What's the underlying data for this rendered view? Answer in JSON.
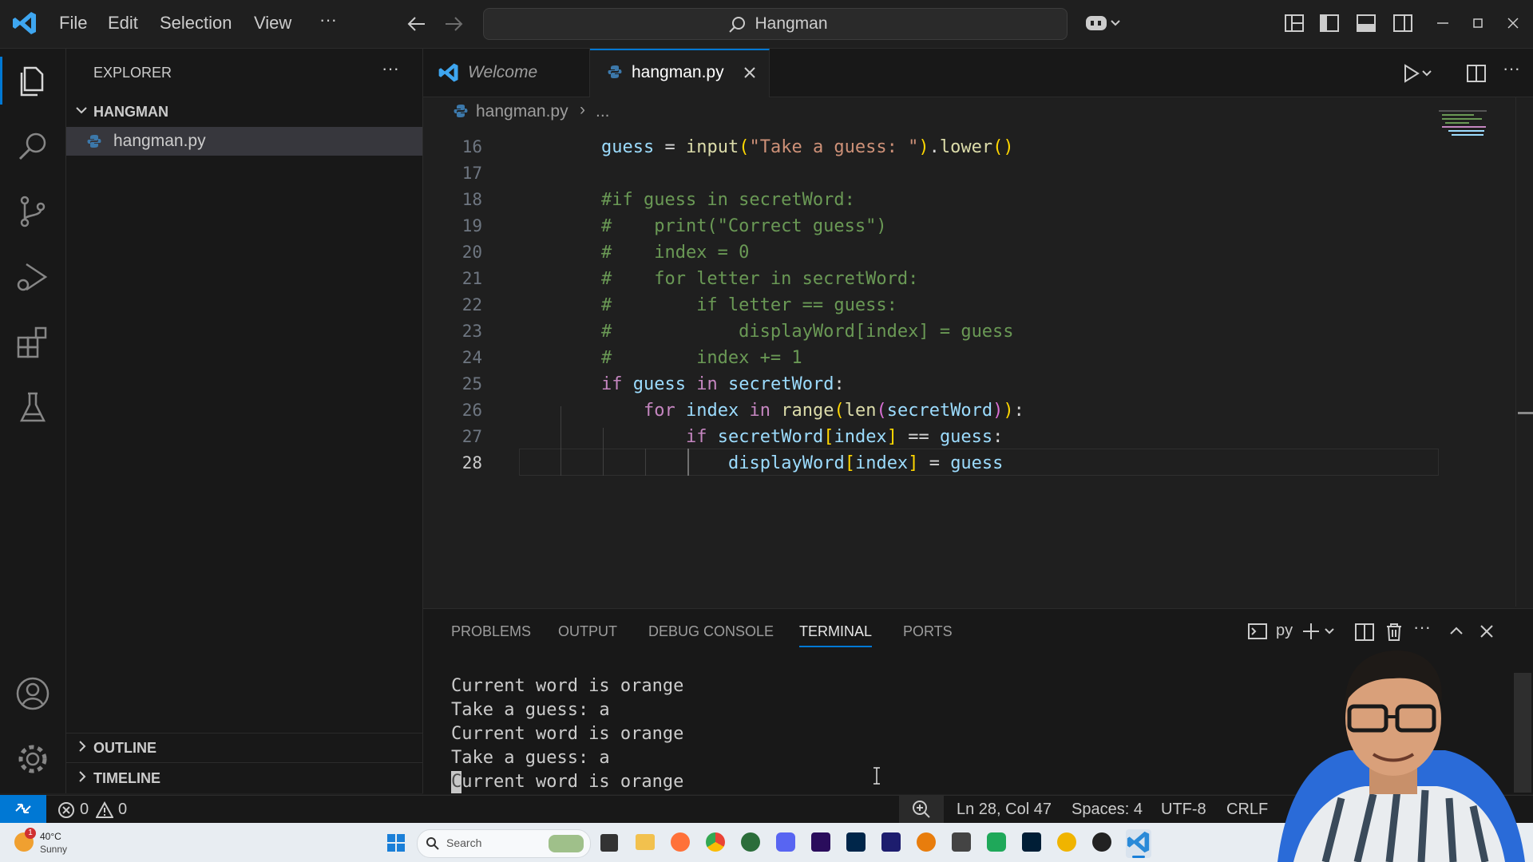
{
  "titlebar": {
    "menu": [
      "File",
      "Edit",
      "Selection",
      "View"
    ],
    "more": "···",
    "search_text": "Hangman"
  },
  "sidebar": {
    "title": "EXPLORER",
    "folder": "HANGMAN",
    "file": "hangman.py",
    "outline": "OUTLINE",
    "timeline": "TIMELINE"
  },
  "tabs": [
    {
      "label": "Welcome",
      "active": false
    },
    {
      "label": "hangman.py",
      "active": true
    }
  ],
  "breadcrumb": {
    "file": "hangman.py",
    "rest": "..."
  },
  "editor": {
    "line_numbers": [
      "16",
      "17",
      "18",
      "19",
      "20",
      "21",
      "22",
      "23",
      "24",
      "25",
      "26",
      "27",
      "28"
    ],
    "current_line": "28",
    "code_lines": [
      "    guess = input(\"Take a guess: \").lower()",
      "",
      "    #if guess in secretWord:",
      "    #    print(\"Correct guess\")",
      "    #    index = 0",
      "    #    for letter in secretWord:",
      "    #        if letter == guess:",
      "    #            displayWord[index] = guess",
      "    #        index += 1",
      "    if guess in secretWord:",
      "        for index in range(len(secretWord)):",
      "            if secretWord[index] == guess:",
      "                displayWord[index] = guess"
    ]
  },
  "panel": {
    "tabs": [
      "PROBLEMS",
      "OUTPUT",
      "DEBUG CONSOLE",
      "TERMINAL",
      "PORTS"
    ],
    "active_tab": "TERMINAL",
    "terminal_name": "py",
    "terminal_lines": [
      "Current word is orange",
      "Take a guess: a",
      "Current word is orange",
      "Take a guess: a",
      "Current word is orange"
    ]
  },
  "statusbar": {
    "errors": "0",
    "warnings": "0",
    "position": "Ln 28, Col 47",
    "spaces": "Spaces: 4",
    "encoding": "UTF-8",
    "eol": "CRLF"
  },
  "taskbar": {
    "weather_temp": "40°C",
    "weather_desc": "Sunny",
    "search": "Search",
    "weather_badge": "1"
  },
  "colors": {
    "accent": "#0078d4",
    "remote": "#0078d4",
    "keyword": "#c586c0",
    "comment": "#6a9955",
    "string": "#ce9178"
  }
}
